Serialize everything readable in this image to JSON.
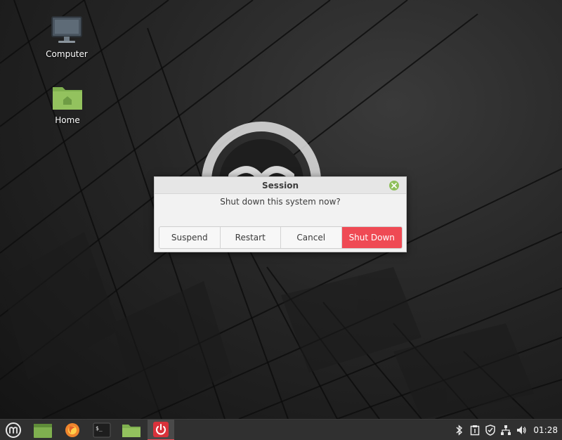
{
  "desktop": {
    "icons": [
      {
        "label": "Computer",
        "icon": "computer-icon"
      },
      {
        "label": "Home",
        "icon": "home-folder-icon"
      }
    ]
  },
  "dialog": {
    "title": "Session",
    "message": "Shut down this system now?",
    "buttons": {
      "suspend": "Suspend",
      "restart": "Restart",
      "cancel": "Cancel",
      "shutdown": "Shut Down"
    },
    "accent_color": "#ef4a54"
  },
  "taskbar": {
    "apps": [
      {
        "name": "mint-menu-icon"
      },
      {
        "name": "files-icon"
      },
      {
        "name": "firefox-icon"
      },
      {
        "name": "terminal-icon"
      },
      {
        "name": "folder-icon"
      },
      {
        "name": "power-icon"
      }
    ],
    "tray": [
      "bluetooth-icon",
      "clipboard-icon",
      "shield-icon",
      "network-icon",
      "volume-icon"
    ],
    "clock": "01:28"
  }
}
